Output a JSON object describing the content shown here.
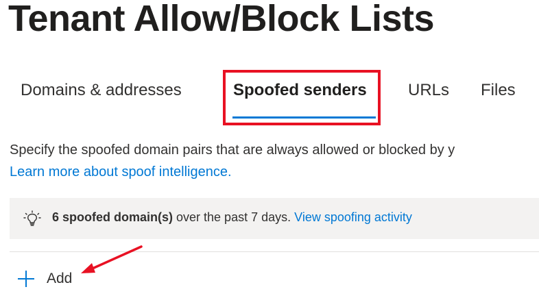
{
  "page": {
    "title": "Tenant Allow/Block Lists"
  },
  "tabs": [
    {
      "label": "Domains & addresses"
    },
    {
      "label": "Spoofed senders"
    },
    {
      "label": "URLs"
    },
    {
      "label": "Files"
    }
  ],
  "active_tab": "Spoofed senders",
  "description": {
    "text": "Specify the spoofed domain pairs that are always allowed or blocked by y",
    "link": "Learn more about spoof intelligence."
  },
  "info_bar": {
    "icon": "lightbulb-icon",
    "count_text": "6 spoofed domain(s)",
    "rest_text": " over the past 7 days.",
    "link": "View spoofing activity"
  },
  "toolbar": {
    "add_label": "Add",
    "add_icon": "plus-icon"
  },
  "colors": {
    "accent": "#0078d4",
    "highlight": "#e81123",
    "info_bar_bg": "#f3f2f1"
  }
}
